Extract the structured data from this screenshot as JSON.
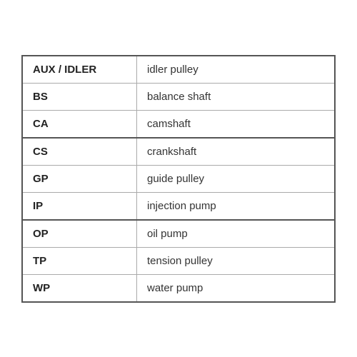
{
  "table": {
    "rows": [
      {
        "abbr": "AUX / IDLER",
        "desc": "idler pulley",
        "thickBorder": false
      },
      {
        "abbr": "BS",
        "desc": "balance shaft",
        "thickBorder": false
      },
      {
        "abbr": "CA",
        "desc": "camshaft",
        "thickBorder": true
      },
      {
        "abbr": "CS",
        "desc": "crankshaft",
        "thickBorder": false
      },
      {
        "abbr": "GP",
        "desc": "guide pulley",
        "thickBorder": false
      },
      {
        "abbr": "IP",
        "desc": "injection pump",
        "thickBorder": true
      },
      {
        "abbr": "OP",
        "desc": "oil pump",
        "thickBorder": false
      },
      {
        "abbr": "TP",
        "desc": "tension pulley",
        "thickBorder": false
      },
      {
        "abbr": "WP",
        "desc": "water pump",
        "thickBorder": false
      }
    ]
  }
}
